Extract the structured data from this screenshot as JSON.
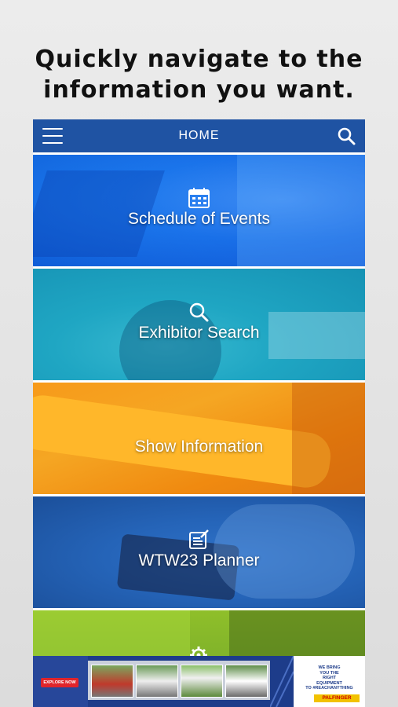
{
  "headline": "Quickly navigate to the\ninformation you want.",
  "appbar": {
    "title": "HOME",
    "bg": "#1f53a3"
  },
  "tiles": [
    {
      "label": "Schedule of Events",
      "icon": "calendar-icon",
      "color": "#1d7df0"
    },
    {
      "label": "Exhibitor Search",
      "icon": "search-icon",
      "color": "#1fa6c3"
    },
    {
      "label": "Show Information",
      "icon": "",
      "color": "#f5a623"
    },
    {
      "label": "WTW23 Planner",
      "icon": "notepad-icon",
      "color": "#2564b8"
    },
    {
      "label": "",
      "icon": "gear-icon",
      "color": "#7db02a"
    }
  ],
  "ad": {
    "button": "EXPLORE NOW",
    "tagline": "WE BRING\nYOU THE\nRIGHT\nEQUIPMENT\nTO #REACHANYTHING",
    "brand": "PALFINGER"
  }
}
